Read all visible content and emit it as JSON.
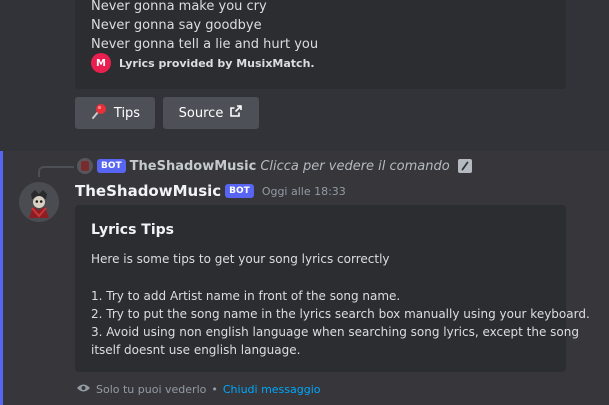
{
  "previous_message": {
    "lyrics_lines": [
      "Never gonna make you cry",
      "Never gonna say goodbye",
      "Never gonna tell a lie and hurt you"
    ],
    "provider_text": "Lyrics provided by MusixMatch.",
    "provider_logo_letter": "M",
    "buttons": {
      "tips_label": "Tips",
      "tips_icon": "pushpin-icon",
      "source_label": "Source",
      "source_icon": "external-link-icon"
    }
  },
  "reply": {
    "name": "TheShadowMusic",
    "bot_tag": "BOT",
    "text": "Clicca per vedere il comando"
  },
  "message": {
    "author": "TheShadowMusic",
    "bot_tag": "BOT",
    "timestamp": "Oggi alle 18:33",
    "embed": {
      "title": "Lyrics Tips",
      "lines": [
        "Here is some tips to get your song lyrics correctly",
        "",
        "1. Try to add Artist name in front of the song name.",
        "2. Try to put the song name in the lyrics search box manually using your keyboard.",
        "3. Avoid using non english language when searching song lyrics, except the song",
        "itself doesnt use english language."
      ]
    },
    "ephemeral": {
      "text": "Solo tu puoi vederlo",
      "separator": "•",
      "dismiss_label": "Chiudi messaggio"
    }
  },
  "colors": {
    "background": "#313338",
    "embed_bg": "#2b2d31",
    "accent_bar": "#5865f2",
    "bot_tag": "#5865f2",
    "link": "#00a8fc",
    "musixmatch": "#e9204f"
  }
}
